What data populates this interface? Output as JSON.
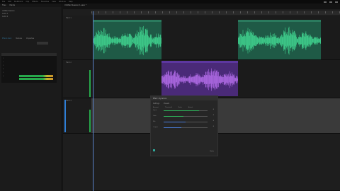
{
  "menubar": {
    "items": [
      "File",
      "Edit",
      "Multitrack",
      "Clip",
      "Effects",
      "Favorites",
      "View",
      "Window",
      "Help"
    ]
  },
  "left_panel": {
    "tabs": [
      "Files",
      "Media"
    ],
    "files": [
      "Untitled Session",
      "Audio 1",
      "Audio 2"
    ],
    "effects_tabs": [
      "Effects Rack",
      "Markers",
      "Properties"
    ],
    "mixer_lines": [
      "1",
      "2",
      "3",
      "4",
      "5",
      "6"
    ]
  },
  "timeline": {
    "title": "Untitled Session 1.sesx *",
    "tracks": [
      {
        "name": "Track 1"
      },
      {
        "name": "Track 2"
      },
      {
        "name": "Track 3"
      }
    ],
    "colors": {
      "green_clip": "#1f5a46",
      "green_wave": "#3fd18e",
      "purple_clip": "#4a2a78",
      "purple_wave": "#b06be6",
      "selection": "#3a3a3a",
      "accent": "#2f7fd6"
    }
  },
  "dialog": {
    "title": "Effect - Dynamics",
    "tabs": [
      "Settings",
      "Presets"
    ],
    "param_headers": [
      "Amount",
      "Threshold",
      "Ratio",
      "Attack"
    ],
    "sliders": [
      {
        "label": "Input",
        "value": "0",
        "fill": 0.8,
        "style": "green"
      },
      {
        "label": "Gain",
        "value": "0",
        "fill": 0.45,
        "style": "green"
      },
      {
        "label": "Mix",
        "value": "0",
        "fill": 0.5,
        "style": "blue"
      },
      {
        "label": "Output",
        "value": "0",
        "fill": 0.4,
        "style": "blue"
      }
    ],
    "footer": "Apply"
  }
}
